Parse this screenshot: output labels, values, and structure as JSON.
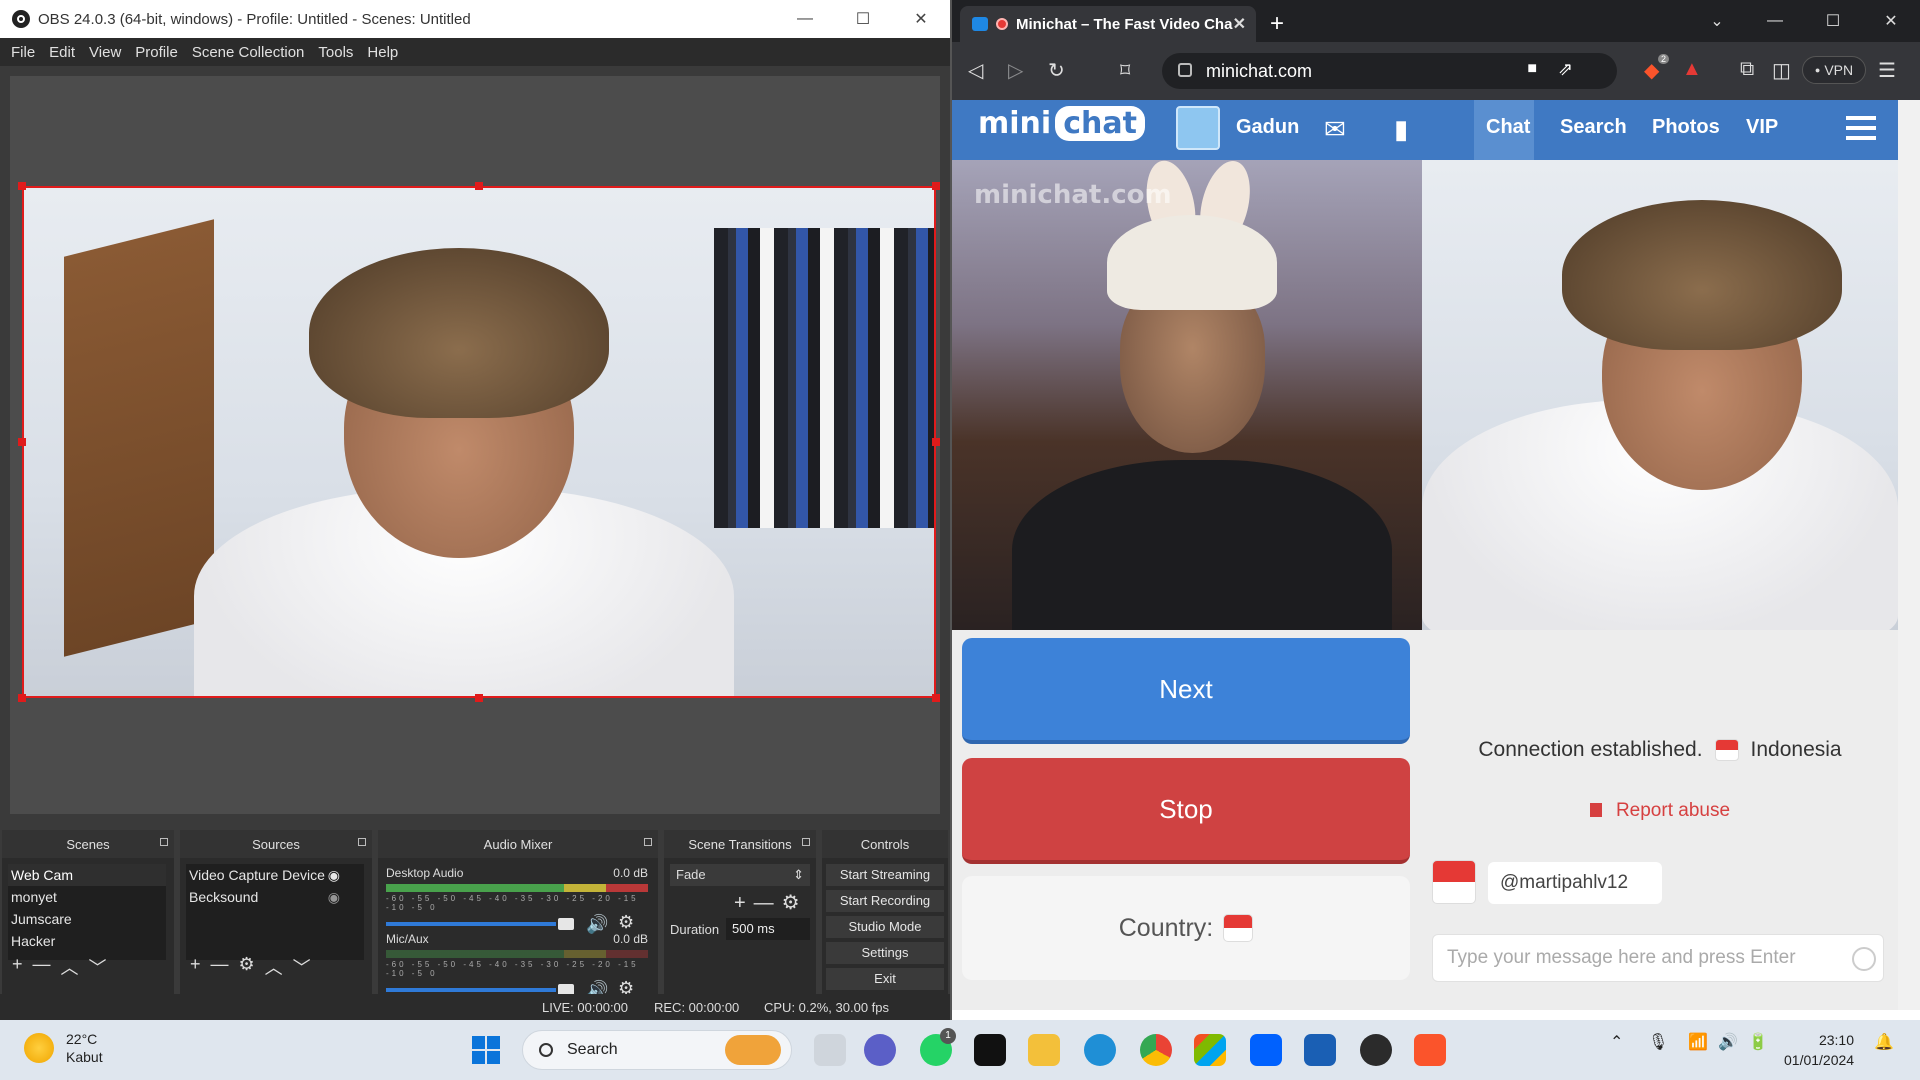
{
  "obs": {
    "title": "OBS 24.0.3 (64-bit, windows) - Profile: Untitled - Scenes: Untitled",
    "menu": [
      "File",
      "Edit",
      "View",
      "Profile",
      "Scene Collection",
      "Tools",
      "Help"
    ],
    "scenes": {
      "title": "Scenes",
      "items": [
        "Web Cam",
        "monyet",
        "Jumscare",
        "Hacker"
      ],
      "selected": "Web Cam"
    },
    "sources": {
      "title": "Sources",
      "items": [
        "Video Capture Device",
        "Becksound"
      ]
    },
    "mixer": {
      "title": "Audio Mixer",
      "channels": [
        {
          "name": "Desktop Audio",
          "level": "0.0 dB"
        },
        {
          "name": "Mic/Aux",
          "level": "0.0 dB"
        }
      ],
      "scale": "-60 -55 -50 -45 -40 -35 -30 -25 -20 -15 -10 -5 0"
    },
    "transitions": {
      "title": "Scene Transitions",
      "selected": "Fade",
      "duration_label": "Duration",
      "duration_value": "500 ms"
    },
    "controls": {
      "title": "Controls",
      "buttons": [
        "Start Streaming",
        "Start Recording",
        "Studio Mode",
        "Settings",
        "Exit"
      ]
    },
    "status": {
      "live": "LIVE: 00:00:00",
      "rec": "REC: 00:00:00",
      "cpu": "CPU: 0.2%, 30.00 fps"
    }
  },
  "browser": {
    "tab_title": "Minichat – The Fast Video Cha",
    "url": "minichat.com",
    "vpn": "VPN",
    "brave_badge": "2"
  },
  "site": {
    "logo_mini": "mini",
    "logo_chat": "chat",
    "watermark": "minichat.com",
    "username": "Gadun",
    "nav": [
      "Chat",
      "Search",
      "Photos",
      "VIP"
    ],
    "active_nav": "Chat",
    "next_label": "Next",
    "stop_label": "Stop",
    "country_label": "Country:",
    "connection_text": "Connection established.",
    "country_name": "Indonesia",
    "report_label": "Report abuse",
    "message": "@martipahlv12",
    "chat_placeholder": "Type your message here and press Enter"
  },
  "taskbar": {
    "temperature": "22°C",
    "weather": "Kabut",
    "search": "Search",
    "time": "23:10",
    "date": "01/01/2024",
    "badge": "1"
  },
  "colors": {
    "site_blue": "#3f79c3",
    "next_blue": "#3d82d8",
    "stop_red": "#cf4242",
    "obs_selection_red": "#e01b1b"
  }
}
